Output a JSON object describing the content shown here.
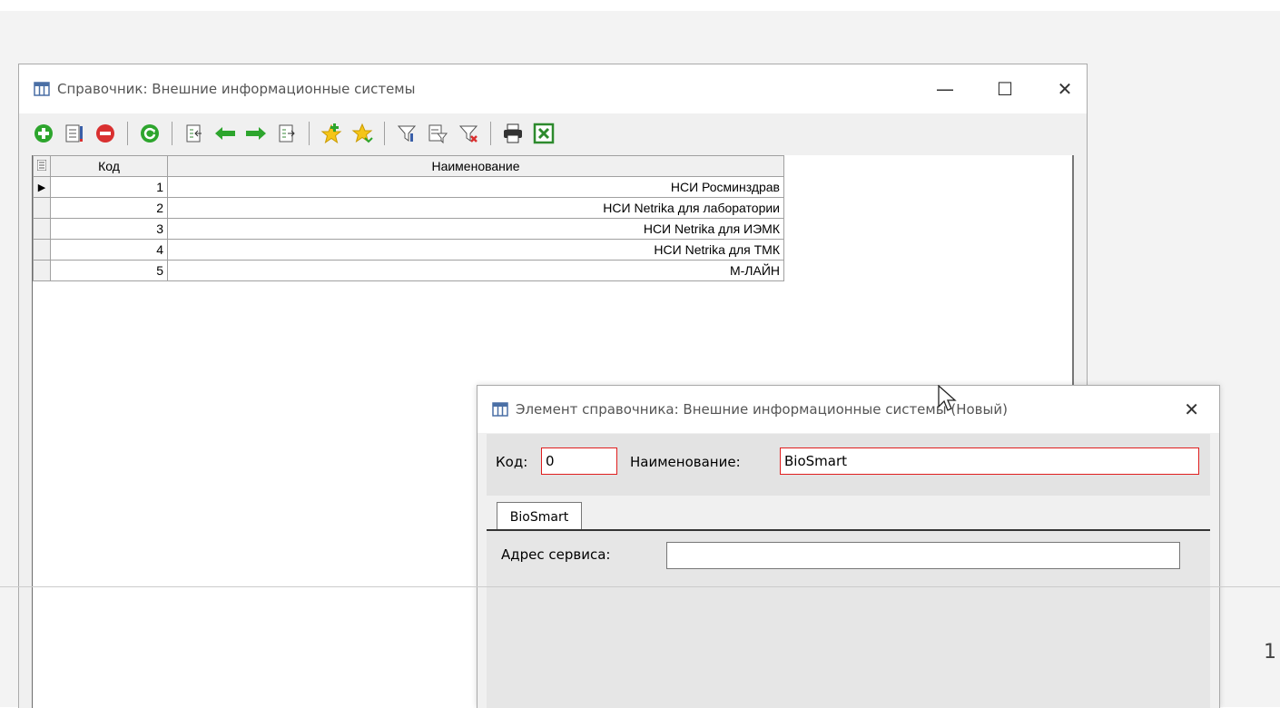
{
  "main_window": {
    "title": "Справочник: Внешние информационные системы",
    "controls": {
      "minimize": "—",
      "maximize": "☐",
      "close": "✕"
    },
    "toolbar": [
      "add-icon",
      "edit-icon",
      "delete-icon",
      "refresh-icon",
      "move-first-icon",
      "arrow-left-icon",
      "arrow-right-icon",
      "move-last-icon",
      "favorite-add-icon",
      "favorite-icon",
      "filter-icon",
      "filter-edit-icon",
      "filter-clear-icon",
      "print-icon",
      "excel-icon"
    ],
    "grid": {
      "columns": [
        "Код",
        "Наименование"
      ],
      "rows": [
        {
          "code": "1",
          "name": "НСИ Росминздрав"
        },
        {
          "code": "2",
          "name": "НСИ Netrika для лаборатории"
        },
        {
          "code": "3",
          "name": "НСИ Netrika для ИЭМК"
        },
        {
          "code": "4",
          "name": "НСИ Netrika для ТМК"
        },
        {
          "code": "5",
          "name": "М-ЛАЙН"
        }
      ],
      "current_row_marker": "▶"
    }
  },
  "item_window": {
    "title": "Элемент справочника: Внешние информационные системы (Новый)",
    "close": "✕",
    "code_label": "Код:",
    "code_value": "0",
    "name_label": "Наименование:",
    "name_value": "BioSmart",
    "tab": "BioSmart",
    "service_label": "Адрес сервиса:",
    "service_value": ""
  },
  "page": {
    "corner_text": "1"
  },
  "colors": {
    "invalid_border": "#e01e1e",
    "green": "#2da52d",
    "red": "#d93030"
  }
}
